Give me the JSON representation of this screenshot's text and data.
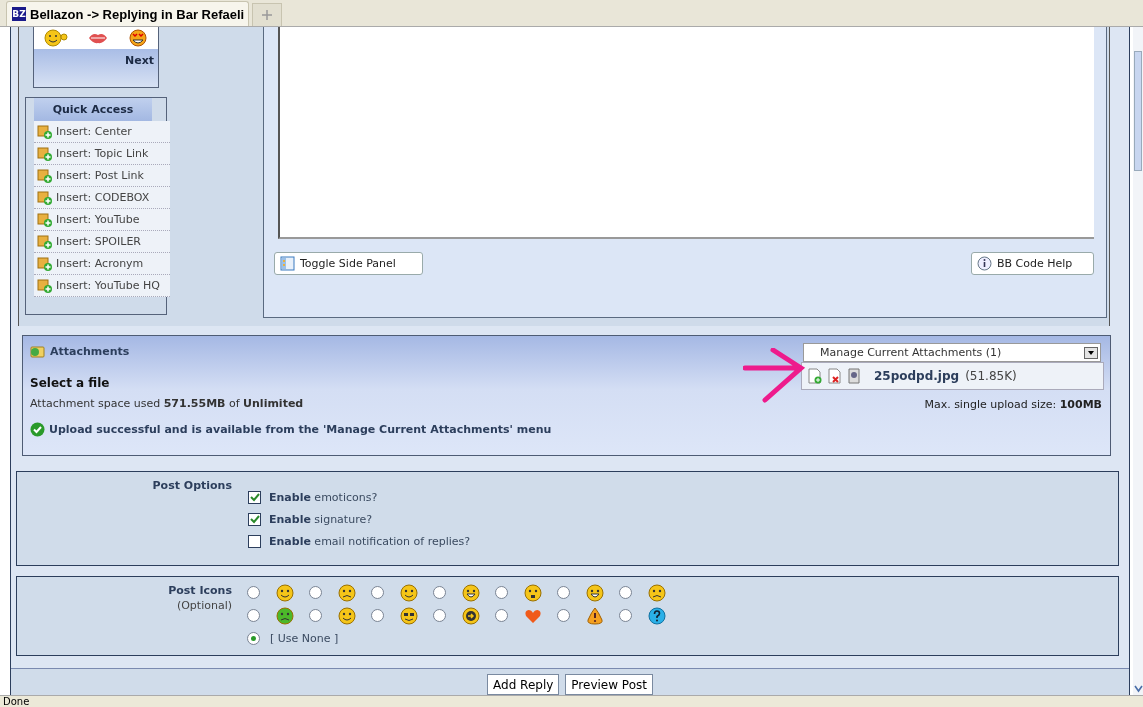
{
  "tab": {
    "logo": "BZ",
    "title": "Bellazon -> Replying in Bar Refaeli"
  },
  "emoticons": {
    "next": "Next"
  },
  "quick_access": {
    "title": "Quick Access",
    "items": [
      {
        "label": "Insert: Center"
      },
      {
        "label": "Insert: Topic Link"
      },
      {
        "label": "Insert: Post Link"
      },
      {
        "label": "Insert: CODEBOX"
      },
      {
        "label": "Insert: YouTube"
      },
      {
        "label": "Insert: SPOILER"
      },
      {
        "label": "Insert: Acronym"
      },
      {
        "label": "Insert: YouTube HQ"
      }
    ]
  },
  "editor": {
    "toggle_button": "Toggle Side Panel",
    "help_button": "BB Code Help"
  },
  "attachments": {
    "title": "Attachments",
    "select_label": "Select a file",
    "space_used": "Attachment space used **571.55MB** of **Unlimited**",
    "max_size": "Max. single upload size: **100MB**",
    "success_message": "Upload successful and is available from the 'Manage Current Attachments' menu",
    "manage_menu": {
      "label": "Manage Current Attachments (1)",
      "expanded": true,
      "files": [
        {
          "name": "25podpd.jpg",
          "size": "(51.85K)"
        }
      ]
    }
  },
  "post_options": {
    "title": "Post Options",
    "options": [
      {
        "label": "**Enable** emoticons?",
        "checked": true
      },
      {
        "label": "**Enable** signature?",
        "checked": true
      },
      {
        "label": "**Enable** email notification of replies?",
        "checked": false
      }
    ]
  },
  "post_icons": {
    "title": "Post Icons",
    "subtitle": "(Optional)",
    "icons": [
      {
        "kind": "smile",
        "selected": false
      },
      {
        "kind": "frown",
        "selected": false
      },
      {
        "kind": "sleepy",
        "selected": false
      },
      {
        "kind": "grin",
        "selected": false
      },
      {
        "kind": "shocked",
        "selected": false
      },
      {
        "kind": "laugh",
        "selected": false
      },
      {
        "kind": "angry",
        "selected": false
      },
      {
        "kind": "sick",
        "selected": false
      },
      {
        "kind": "eyes",
        "selected": false
      },
      {
        "kind": "cool",
        "selected": false
      },
      {
        "kind": "arrow",
        "selected": false
      },
      {
        "kind": "heart",
        "selected": false
      },
      {
        "kind": "warning",
        "selected": false
      },
      {
        "kind": "question",
        "selected": false
      }
    ],
    "use_none": {
      "label": "[ Use None ]",
      "selected": true
    }
  },
  "buttons": [
    "Add Reply",
    "Preview Post"
  ],
  "status_bar": "Done"
}
